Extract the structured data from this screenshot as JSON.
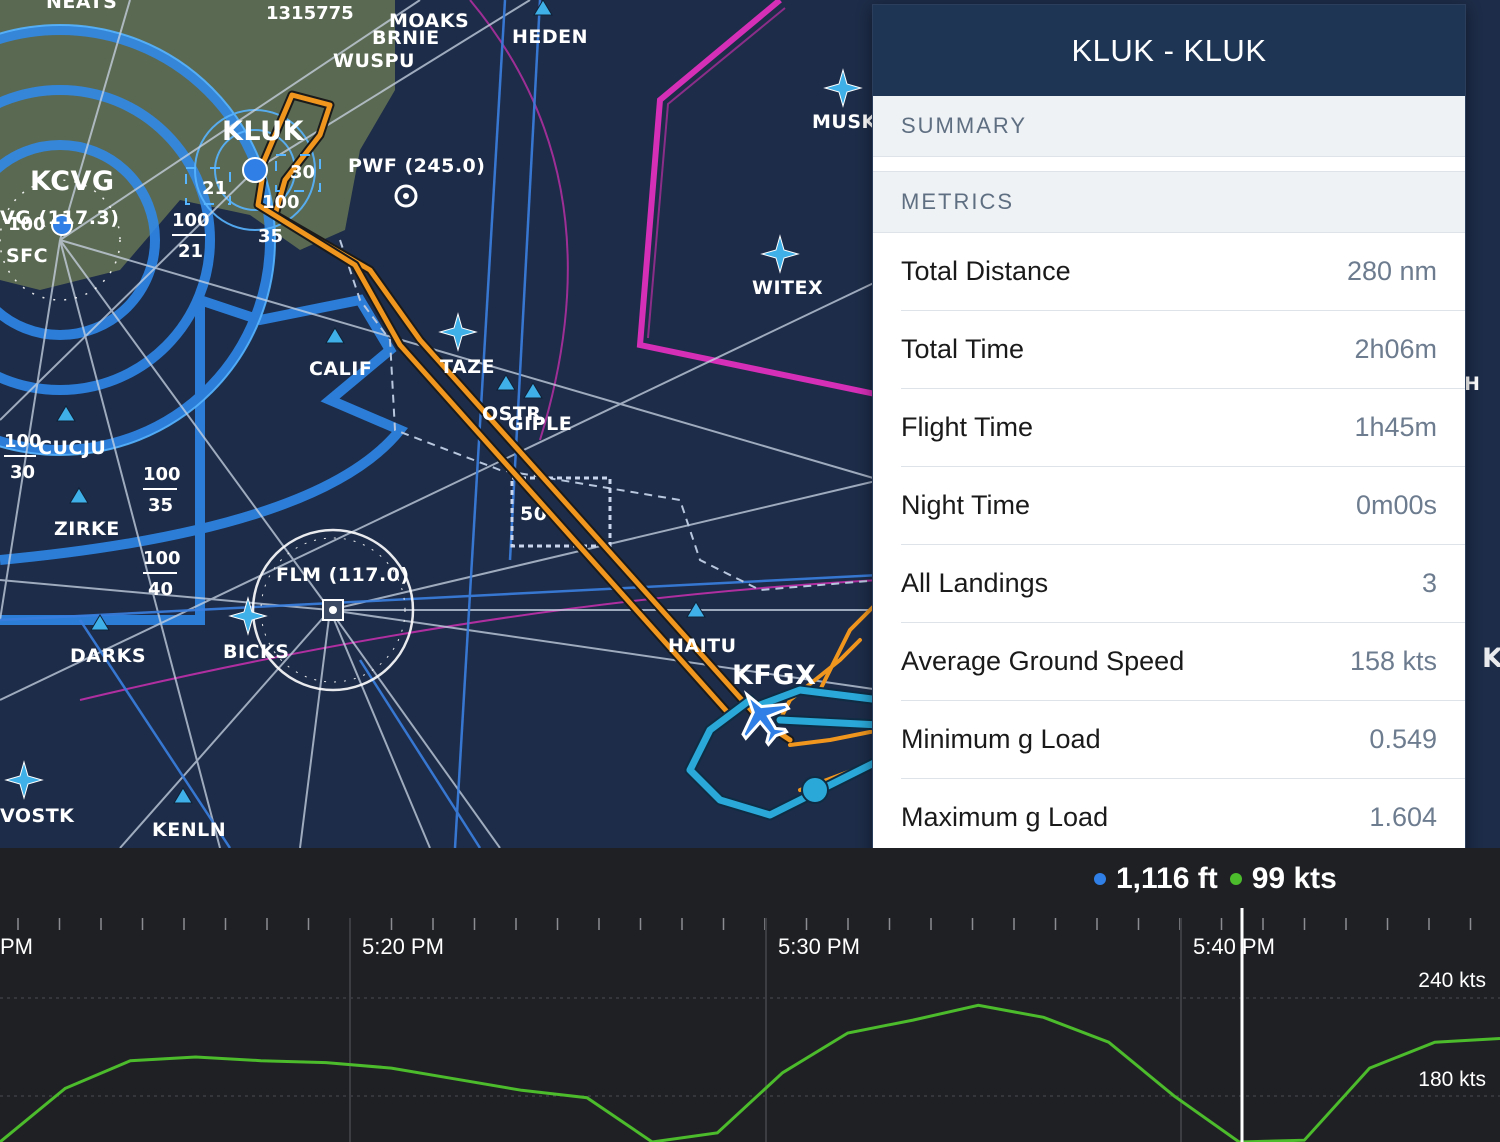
{
  "map": {
    "waypoints": [
      "NEATS",
      "MOAKS",
      "BRNIE",
      "WUSPU",
      "HEDEN",
      "MUSKT",
      "WITEX",
      "CALIF",
      "TAZE",
      "OSTR",
      "GIPLE",
      "CUCJU",
      "ZIRKE",
      "DARKS",
      "BICKS",
      "KENLN",
      "VOSTK",
      "HAITU"
    ],
    "airports": [
      "KCVG",
      "KLUK",
      "KFGX"
    ],
    "navaids": [
      "PWF (245.0)",
      "FLM (117.0)",
      "VG (117.3)"
    ],
    "labels": [
      "SFC",
      "1315775",
      "50"
    ],
    "altitude_blocks": [
      {
        "top": "100",
        "bottom": "30"
      },
      {
        "top": "100",
        "bottom": "35"
      },
      {
        "top": "100",
        "bottom": "40"
      },
      {
        "top": "100",
        "bottom": "21"
      },
      {
        "top": "21",
        "bottom": ""
      },
      {
        "top": "100",
        "bottom": "35"
      },
      {
        "top": "30",
        "bottom": ""
      }
    ],
    "colors": {
      "background": "#1d2c48",
      "class_b": "#2f8cf0",
      "moa": "#d42fb6",
      "track": "#f0961e",
      "track_blue": "#2aa8d8",
      "land": "#5e6d53"
    }
  },
  "panel": {
    "title": "KLUK - KLUK",
    "summary_label": "SUMMARY",
    "metrics_label": "METRICS",
    "metrics": [
      {
        "label": "Total Distance",
        "value": "280 nm"
      },
      {
        "label": "Total Time",
        "value": "2h06m"
      },
      {
        "label": "Flight Time",
        "value": "1h45m"
      },
      {
        "label": "Night Time",
        "value": "0m00s"
      },
      {
        "label": "All Landings",
        "value": "3"
      },
      {
        "label": "Average Ground Speed",
        "value": "158 kts"
      },
      {
        "label": "Minimum g Load",
        "value": "0.549"
      },
      {
        "label": "Maximum g Load",
        "value": "1.604"
      }
    ]
  },
  "chart": {
    "readout": {
      "altitude": "1,116 ft",
      "speed": "99 kts",
      "altitude_color": "#2f7fe6",
      "speed_color": "#4cbb2c"
    },
    "time_labels": [
      "PM",
      "5:20 PM",
      "5:30 PM",
      "5:40 PM"
    ],
    "y_labels": [
      "240 kts",
      "180 kts"
    ]
  },
  "chart_data": {
    "type": "line",
    "title": "",
    "xlabel": "",
    "ylabel": "",
    "series": [
      {
        "values": [
          60,
          118,
          148,
          152,
          148,
          146,
          140,
          128,
          116,
          108,
          60,
          70,
          135,
          178,
          192,
          208,
          195,
          168,
          110,
          60,
          62,
          140,
          168,
          172
        ]
      }
    ],
    "ylim": [
      60,
      270
    ],
    "cursor_time": "5:41 PM"
  }
}
